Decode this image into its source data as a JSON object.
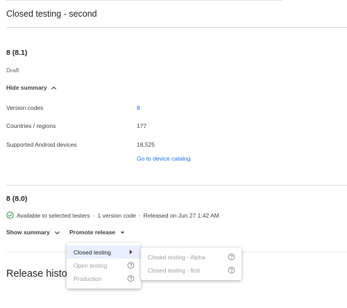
{
  "page": {
    "track_title": "Closed testing - second"
  },
  "release_draft": {
    "title": "8 (8.1)",
    "status": "Draft",
    "summary_toggle": "Hide summary",
    "details": [
      {
        "label": "Version codes",
        "value": "8",
        "is_link": true
      },
      {
        "label": "Countries / regions",
        "value": "177",
        "is_link": false
      },
      {
        "label": "Supported Android devices",
        "value": "18,525",
        "is_link": false
      }
    ],
    "device_catalog_link": "Go to device catalog"
  },
  "release_live": {
    "title": "8 (8.0)",
    "availability": "Available to selected testers",
    "separator": "·",
    "version_count": "1 version code",
    "released": "Released on Jun 27 1:42 AM",
    "summary_toggle": "Show summary",
    "promote_label": "Promote release"
  },
  "release_history": {
    "title": "Release history"
  },
  "promote_menu": {
    "items": [
      {
        "label": "Closed testing",
        "state": "active",
        "icon": "chevron-right-icon"
      },
      {
        "label": "Open testing",
        "state": "disabled",
        "icon": "help-icon"
      },
      {
        "label": "Production",
        "state": "disabled",
        "icon": "help-icon"
      }
    ],
    "submenu": [
      {
        "label": "Closed testing - Alpha",
        "state": "disabled",
        "icon": "help-icon"
      },
      {
        "label": "Closed testing - first",
        "state": "disabled",
        "icon": "help-icon"
      }
    ]
  },
  "colors": {
    "link": "#1a73e8",
    "success": "#1e8e3e",
    "active_bg": "#e8f0fe",
    "disabled_text": "#9aa0a6"
  }
}
